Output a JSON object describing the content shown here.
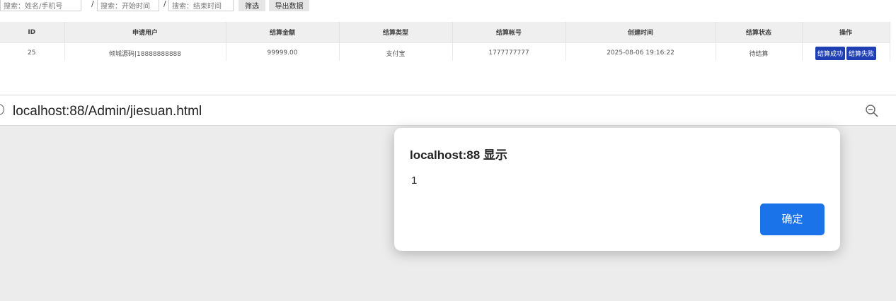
{
  "filters": {
    "name_placeholder": "搜索：姓名/手机号",
    "separator": "/",
    "start_placeholder": "搜索：开始时间",
    "end_placeholder": "搜索：结束时间",
    "filter_button": "筛选",
    "export_button": "导出数据"
  },
  "table": {
    "headers": [
      "ID",
      "申请用户",
      "结算金额",
      "结算类型",
      "结算帐号",
      "创建时间",
      "结算状态",
      "操作"
    ],
    "rows": [
      {
        "id": "25",
        "user": "倾城源码|18888888888",
        "amount": "99999.00",
        "type": "支付宝",
        "account": "1777777777",
        "created": "2025-08-06 19:16:22",
        "status": "待结算",
        "actions": [
          "结算成功",
          "结算失败"
        ]
      }
    ]
  },
  "browser": {
    "url": "localhost:88/Admin/jiesuan.html",
    "zoom_icon": "zoom-out-icon"
  },
  "dialog": {
    "title": "localhost:88 显示",
    "message": "1",
    "ok_label": "确定"
  },
  "colors": {
    "action_button": "#1f3fb3",
    "ok_button": "#1a73e8",
    "page_overlay": "#ececec"
  }
}
